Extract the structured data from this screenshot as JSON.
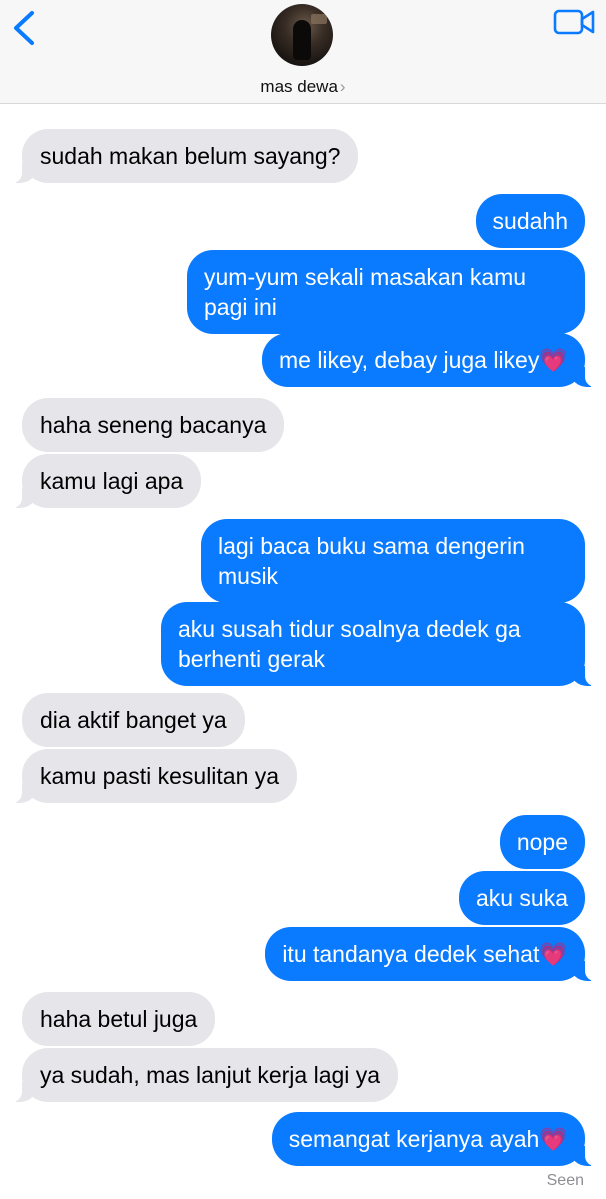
{
  "header": {
    "contact_name": "mas dewa",
    "chevron": "›",
    "icons": {
      "back": "chevron-left-icon",
      "video": "video-camera-icon"
    },
    "accent_color": "#0a7bff"
  },
  "messages": [
    {
      "from": "them",
      "text": "sudah makan belum sayang?"
    },
    {
      "from": "me",
      "text": "sudahh"
    },
    {
      "from": "me",
      "text": "yum-yum sekali masakan kamu pagi ini"
    },
    {
      "from": "me",
      "text": "me likey, debay juga likey",
      "emoji": "💗"
    },
    {
      "from": "them",
      "text": "haha seneng bacanya"
    },
    {
      "from": "them",
      "text": "kamu lagi apa"
    },
    {
      "from": "me",
      "text": "lagi baca buku sama dengerin musik"
    },
    {
      "from": "me",
      "text": "aku susah tidur soalnya dedek ga berhenti gerak"
    },
    {
      "from": "them",
      "text": "dia aktif banget ya"
    },
    {
      "from": "them",
      "text": "kamu pasti kesulitan ya"
    },
    {
      "from": "me",
      "text": "nope"
    },
    {
      "from": "me",
      "text": "aku suka"
    },
    {
      "from": "me",
      "text": "itu tandanya dedek sehat",
      "emoji": "💗"
    },
    {
      "from": "them",
      "text": "haha betul juga"
    },
    {
      "from": "them",
      "text": "ya sudah, mas lanjut kerja lagi ya"
    },
    {
      "from": "me",
      "text": "semangat kerjanya ayah",
      "emoji": "💗"
    }
  ],
  "status": {
    "seen": "Seen"
  },
  "colors": {
    "incoming_bubble": "#e5e5ea",
    "outgoing_bubble": "#0a7bff",
    "heart": "#ff2fa8"
  }
}
